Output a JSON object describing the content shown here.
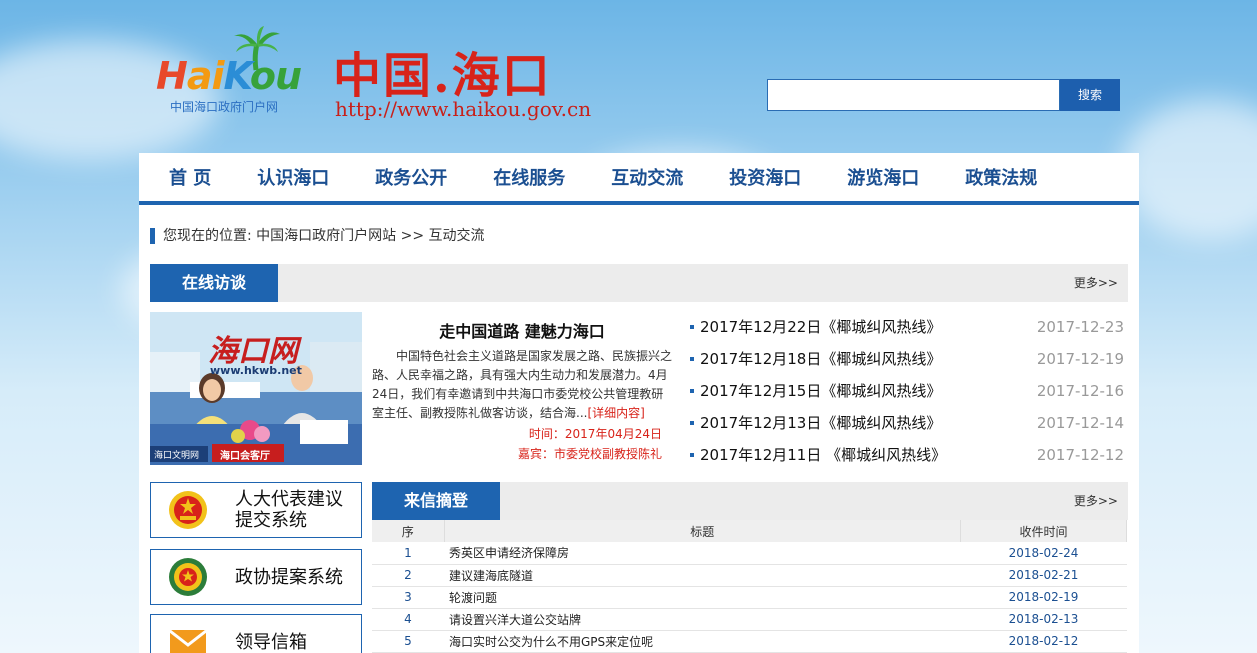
{
  "header": {
    "logo_text": "HaiKou",
    "logo_subtitle": "中国海口政府门户网",
    "site_title": "中国.海口",
    "site_url": "http://www.haikou.gov.cn",
    "search_placeholder": "",
    "search_button": "搜索"
  },
  "nav": {
    "items": [
      "首 页",
      "认识海口",
      "政务公开",
      "在线服务",
      "互动交流",
      "投资海口",
      "游览海口",
      "政策法规"
    ]
  },
  "breadcrumb": "您现在的位置: 中国海口政府门户网站 >> 互动交流",
  "interview": {
    "tab_label": "在线访谈",
    "more": "更多>>",
    "photo_logo": "海口网",
    "photo_url": "www.hkwb.net",
    "photo_banner_left": "海口文明网",
    "photo_banner_center": "海口会客厅",
    "feature_title": "走中国道路 建魅力海口",
    "feature_body": "中国特色社会主义道路是国家发展之路、民族振兴之路、人民幸福之路，具有强大内生动力和发展潜力。4月24日，我们有幸邀请到中共海口市委党校公共管理教研室主任、副教授陈礼做客访谈，结合海...",
    "feature_more": "[详细内容]",
    "feature_time": "时间：2017年04月24日",
    "feature_guest": "嘉宾：市委党校副教授陈礼",
    "news": [
      {
        "title": "2017年12月22日《椰城纠风热线》",
        "date": "2017-12-23"
      },
      {
        "title": "2017年12月18日《椰城纠风热线》",
        "date": "2017-12-19"
      },
      {
        "title": "2017年12月15日《椰城纠风热线》",
        "date": "2017-12-16"
      },
      {
        "title": "2017年12月13日《椰城纠风热线》",
        "date": "2017-12-14"
      },
      {
        "title": "2017年12月11日 《椰城纠风热线》",
        "date": "2017-12-12"
      }
    ]
  },
  "side_links": [
    {
      "label": "人大代表建议提交系统",
      "icon": "npc-emblem-icon"
    },
    {
      "label": "政协提案系统",
      "icon": "cppcc-emblem-icon"
    },
    {
      "label": "领导信箱",
      "icon": "mail-icon"
    }
  ],
  "letters": {
    "tab_label": "来信摘登",
    "more": "更多>>",
    "columns": [
      "序",
      "标题",
      "收件时间"
    ],
    "rows": [
      {
        "no": "1",
        "title": "秀英区申请经济保障房",
        "date": "2018-02-24"
      },
      {
        "no": "2",
        "title": "建议建海底隧道",
        "date": "2018-02-21"
      },
      {
        "no": "3",
        "title": "轮渡问题",
        "date": "2018-02-19"
      },
      {
        "no": "4",
        "title": "请设置兴洋大道公交站牌",
        "date": "2018-02-13"
      },
      {
        "no": "5",
        "title": "海口实时公交为什么不用GPS来定位呢",
        "date": "2018-02-12"
      }
    ]
  },
  "colors": {
    "primary_blue": "#1e64b0",
    "title_red": "#d8231a"
  }
}
